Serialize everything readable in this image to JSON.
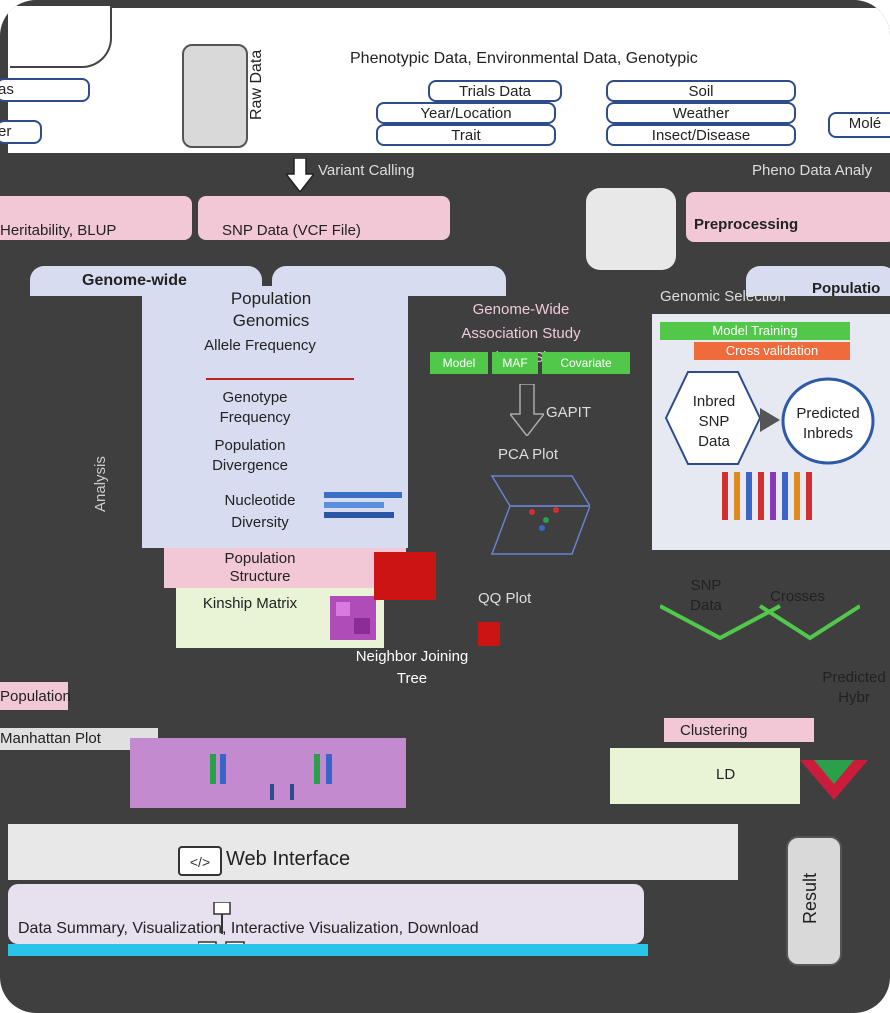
{
  "top": {
    "header_line": "Phenotypic Data, Environmental Data, Genotypic",
    "raw_data_label": "Raw Data",
    "left_labels": [
      "as",
      "er"
    ],
    "pheno_items": [
      "Trials Data",
      "Year/Location",
      "Trait"
    ],
    "env_items": [
      "Soil",
      "Weather",
      "Insect/Disease"
    ],
    "geno_items": [
      "Molé"
    ]
  },
  "processing": {
    "variant_calling": "Variant Calling",
    "pheno_analysis": "Pheno Data Analy",
    "heritability": "Heritability, BLUP",
    "snp_data": "SNP Data (VCF File)",
    "preprocessing": "Preprocessing"
  },
  "sections": {
    "genome_wide": "Genome-wide",
    "popgen_title": "Population Genomics",
    "popgen_items": [
      "Allele Frequency",
      "Genotype Frequency",
      "Population Divergence",
      "Nucleotide Diversity",
      "Population Structure",
      "Kinship Matrix"
    ],
    "gwas_title": "Genome-Wide Association Study (GWAS)",
    "gwas_buttons": [
      "Model",
      "MAF",
      "Covariate"
    ],
    "gapit": "GAPIT",
    "pca_plot": "PCA Plot",
    "qq_plot": "QQ Plot",
    "neighbor": "Neighbor Joining Tree",
    "side_vertical": "Analysis",
    "genomic_selection": "Genomic Selection",
    "gs_buttons": [
      "Model Training",
      "Cross validation"
    ],
    "inbred_snp": "Inbred SNP Data",
    "predicted_inbreds": "Predicted Inbreds",
    "snp_data2": "SNP Data",
    "crosses": "Crosses",
    "predicted_hybr": "Predicted Hybr",
    "clustering": "Clustering",
    "ld": "LD",
    "left_pop": "Population",
    "left_plot": "Manhattan Plot",
    "pop_right": "Populatio"
  },
  "bottom": {
    "web_interface": "Web Interface",
    "bottom_line": "Data Summary, Visualization, Interactive Visualization, Download",
    "result_label": "Result"
  },
  "colors": {
    "dark_bg": "#3f3f3f",
    "pink": "#f2c7d6",
    "lavender": "#d8dcf0",
    "green": "#52c84a",
    "orange": "#ef6b3c",
    "blue_outline": "#2c4c8c"
  }
}
